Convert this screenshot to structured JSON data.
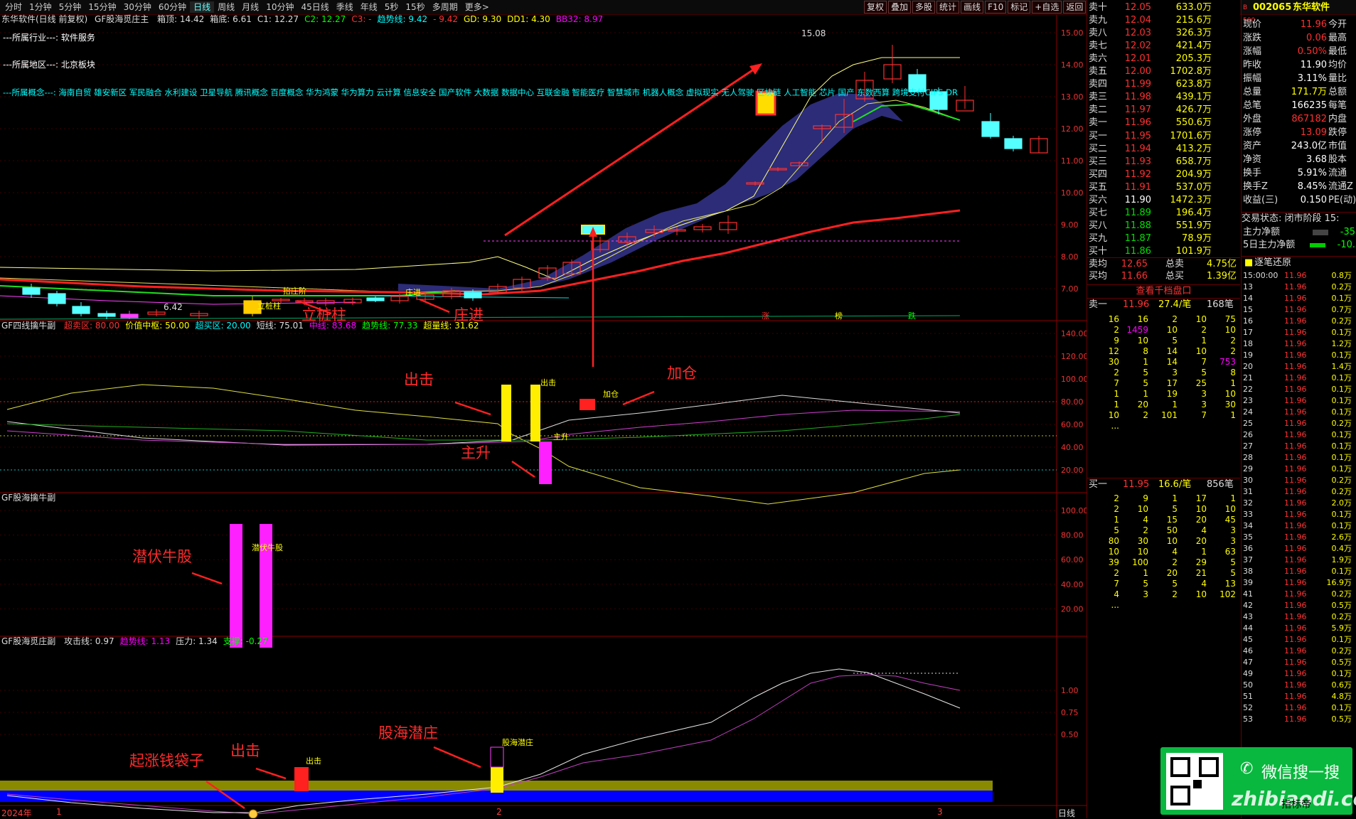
{
  "toolbar": {
    "periods": [
      "分时",
      "1分钟",
      "5分钟",
      "15分钟",
      "30分钟",
      "60分钟",
      "日线",
      "周线",
      "月线",
      "10分钟",
      "45日线",
      "季线",
      "年线",
      "5秒",
      "15秒",
      "多周期",
      "更多>"
    ],
    "active": "日线",
    "right_buttons": [
      "复权",
      "叠加",
      "多股",
      "统计",
      "画线",
      "F10",
      "标记",
      "+自选",
      "返回"
    ]
  },
  "main_panel": {
    "title_stock": "东华软件(日线 前复权)",
    "indicator": "GF股海觅庄主",
    "params": [
      {
        "t": "箱顶: 14.42",
        "c": "#ddd"
      },
      {
        "t": "箱底: 6.61",
        "c": "#ddd"
      },
      {
        "t": "C1: 12.27",
        "c": "#ddd"
      },
      {
        "t": "C2: 12.27",
        "c": "#0f0"
      },
      {
        "t": "C3: -",
        "c": "#f33"
      },
      {
        "t": "趋势线: 9.42",
        "c": "#0ff"
      },
      {
        "t": "- 9.42",
        "c": "#f33"
      },
      {
        "t": "GD: 9.30",
        "c": "#ff0"
      },
      {
        "t": "DD1: 4.30",
        "c": "#ff0"
      },
      {
        "t": "BB32: 8.97",
        "c": "#f0f"
      }
    ],
    "industry": "---所属行业---: 软件服务",
    "region": "---所属地区---: 北京板块",
    "concepts": "---所属概念---: 海南自贸 雄安新区 军民融合 水利建设 卫星导航 腾讯概念 百度概念 华为鸿蒙 华为算力 云计算 信息安全 国产软件 大数据 数据中心 互联金融 智能医疗 智慧城市 机器人概念 虚拟现实 无人驾驶 区块链 人工智能 芯片 国产 东数西算 跨境支付CIPS DR",
    "yticks": [
      "15.00",
      "14.00",
      "13.00",
      "12.00",
      "11.00",
      "10.00",
      "9.00",
      "8.00",
      "7.00"
    ],
    "high_label": "15.08",
    "low_label": "6.42",
    "small_labels": [
      "抬庄阶",
      "立桩柱",
      "庄进",
      "涨",
      "榜",
      "跌"
    ],
    "annotations": [
      "立桩柱",
      "庄进"
    ]
  },
  "panel2": {
    "title": "GF四线擒牛副",
    "params": [
      {
        "t": "超卖区: 80.00",
        "c": "#f33"
      },
      {
        "t": "价值中枢: 50.00",
        "c": "#ff0"
      },
      {
        "t": "超买区: 20.00",
        "c": "#0ff"
      },
      {
        "t": "短线: 75.01",
        "c": "#ddd"
      },
      {
        "t": "中线: 83.68",
        "c": "#f0f"
      },
      {
        "t": "趋势线: 77.33",
        "c": "#0f0"
      },
      {
        "t": "超量线: 31.62",
        "c": "#ff0"
      }
    ],
    "yticks": [
      "140.00",
      "120.00",
      "100.00",
      "80.00",
      "60.00",
      "40.00",
      "20.00"
    ],
    "small_labels": [
      "出击",
      "加仓",
      "主升"
    ],
    "annotations": [
      "出击",
      "加仓",
      "主升"
    ]
  },
  "panel3": {
    "title": "GF股海擒牛副",
    "yticks": [
      "100.00",
      "80.00",
      "60.00",
      "40.00",
      "20.00"
    ],
    "small_label": "潜伏牛股",
    "annotation": "潜伏牛股"
  },
  "panel4": {
    "title": "GF股海觅庄副",
    "params": [
      {
        "t": "攻击线: 0.97",
        "c": "#ddd"
      },
      {
        "t": "趋势线: 1.13",
        "c": "#f0f"
      },
      {
        "t": "压力: 1.34",
        "c": "#ddd"
      },
      {
        "t": "支撑: -0.27",
        "c": "#0f0"
      }
    ],
    "yticks": [
      "1.00",
      "0.75",
      "0.50"
    ],
    "small_labels": [
      "出击",
      "股海潜庄"
    ],
    "annotations": [
      "起涨钱袋子",
      "出击",
      "股海潜庄"
    ]
  },
  "xaxis": {
    "labels": [
      "2024年",
      "1",
      "2",
      "3"
    ],
    "period": "日线"
  },
  "orderbook": {
    "asks": [
      {
        "l": "卖十",
        "p": "12.05",
        "v": "633.0万"
      },
      {
        "l": "卖九",
        "p": "12.04",
        "v": "215.6万"
      },
      {
        "l": "卖八",
        "p": "12.03",
        "v": "326.3万"
      },
      {
        "l": "卖七",
        "p": "12.02",
        "v": "421.4万"
      },
      {
        "l": "卖六",
        "p": "12.01",
        "v": "205.3万"
      },
      {
        "l": "卖五",
        "p": "12.00",
        "v": "1702.8万"
      },
      {
        "l": "卖四",
        "p": "11.99",
        "v": "623.8万"
      },
      {
        "l": "卖三",
        "p": "11.98",
        "v": "439.1万"
      },
      {
        "l": "卖二",
        "p": "11.97",
        "v": "426.7万"
      },
      {
        "l": "卖一",
        "p": "11.96",
        "v": "550.6万"
      }
    ],
    "bids": [
      {
        "l": "买一",
        "p": "11.95",
        "v": "1701.6万"
      },
      {
        "l": "买二",
        "p": "11.94",
        "v": "413.2万"
      },
      {
        "l": "买三",
        "p": "11.93",
        "v": "658.7万"
      },
      {
        "l": "买四",
        "p": "11.92",
        "v": "204.9万"
      },
      {
        "l": "买五",
        "p": "11.91",
        "v": "537.0万"
      },
      {
        "l": "买六",
        "p": "11.90",
        "v": "1472.3万"
      },
      {
        "l": "买七",
        "p": "11.89",
        "v": "196.4万"
      },
      {
        "l": "买八",
        "p": "11.88",
        "v": "551.9万"
      },
      {
        "l": "买九",
        "p": "11.87",
        "v": "78.9万"
      },
      {
        "l": "买十",
        "p": "11.86",
        "v": "101.9万"
      }
    ],
    "avg_ask": {
      "l": "卖均",
      "p": "12.65",
      "s": "总卖",
      "v": "4.75亿"
    },
    "avg_bid": {
      "l": "买均",
      "p": "11.66",
      "s": "总买",
      "v": "1.39亿"
    },
    "thousand_btn": "查看千档盘口",
    "sell_queue_header": {
      "l": "卖一",
      "p": "11.96",
      "a": "27.4/笔",
      "n": "168笔"
    },
    "sell_queue": [
      [
        "16",
        "16",
        "2",
        "10",
        "75"
      ],
      [
        "2",
        "1459",
        "10",
        "2",
        "10"
      ],
      [
        "9",
        "10",
        "5",
        "1",
        "2"
      ],
      [
        "12",
        "8",
        "14",
        "10",
        "2"
      ],
      [
        "30",
        "1",
        "14",
        "7",
        "753"
      ],
      [
        "2",
        "5",
        "3",
        "5",
        "8"
      ],
      [
        "7",
        "5",
        "17",
        "25",
        "1"
      ],
      [
        "1",
        "1",
        "19",
        "3",
        "10"
      ],
      [
        "1",
        "20",
        "1",
        "3",
        "30"
      ],
      [
        "10",
        "2",
        "101",
        "7",
        "1"
      ],
      [
        "...",
        "",
        "",
        "",
        ""
      ]
    ],
    "buy_queue_header": {
      "l": "买一",
      "p": "11.95",
      "a": "16.6/笔",
      "n": "856笔"
    },
    "buy_queue": [
      [
        "2",
        "9",
        "1",
        "17",
        "1"
      ],
      [
        "2",
        "10",
        "5",
        "10",
        "10"
      ],
      [
        "1",
        "4",
        "15",
        "20",
        "45"
      ],
      [
        "5",
        "2",
        "50",
        "4",
        "3"
      ],
      [
        "80",
        "30",
        "10",
        "20",
        "3"
      ],
      [
        "10",
        "10",
        "4",
        "1",
        "63"
      ],
      [
        "39",
        "100",
        "2",
        "29",
        "5"
      ],
      [
        "2",
        "1",
        "20",
        "21",
        "5"
      ],
      [
        "7",
        "5",
        "5",
        "4",
        "13"
      ],
      [
        "4",
        "3",
        "2",
        "10",
        "102"
      ],
      [
        "...",
        "",
        "",
        "",
        ""
      ]
    ]
  },
  "quote": {
    "code": "002065",
    "name": "东华软件",
    "rows": [
      {
        "a": "现价",
        "b": "11.96",
        "bc": "red",
        "c": "今开"
      },
      {
        "a": "涨跌",
        "b": "0.06",
        "bc": "red",
        "c": "最高"
      },
      {
        "a": "涨幅",
        "b": "0.50%",
        "bc": "red",
        "c": "最低"
      },
      {
        "a": "昨收",
        "b": "11.90",
        "bc": "wht",
        "c": "均价"
      },
      {
        "a": "振幅",
        "b": "3.11%",
        "bc": "wht",
        "c": "量比"
      },
      {
        "a": "总量",
        "b": "171.7万",
        "bc": "yel",
        "c": "总额"
      },
      {
        "a": "总笔",
        "b": "166235",
        "bc": "wht",
        "c": "每笔"
      },
      {
        "a": "外盘",
        "b": "867182",
        "bc": "red",
        "c": "内盘"
      },
      {
        "a": "涨停",
        "b": "13.09",
        "bc": "red",
        "c": "跌停"
      },
      {
        "a": "资产",
        "b": "243.0亿",
        "bc": "wht",
        "c": "市值"
      },
      {
        "a": "净资",
        "b": "3.68",
        "bc": "wht",
        "c": "股本"
      },
      {
        "a": "换手",
        "b": "5.91%",
        "bc": "wht",
        "c": "流通"
      },
      {
        "a": "换手Z",
        "b": "8.45%",
        "bc": "wht",
        "c": "流通Z"
      },
      {
        "a": "收益(三)",
        "b": "0.150",
        "bc": "wht",
        "c": "PE(动)"
      }
    ],
    "trade_status": "交易状态: 闭市阶段 15:",
    "main_net": {
      "a": "主力净额",
      "v": "-35"
    },
    "main_net5": {
      "a": "5日主力净额",
      "v": "-10."
    },
    "ticks_title": "逐笔还原",
    "ticks": [
      {
        "t": "15:00:00",
        "p": "11.96",
        "v": "0.8万"
      },
      {
        "t": "13",
        "p": "11.96",
        "v": "0.2万"
      },
      {
        "t": "14",
        "p": "11.96",
        "v": "0.1万"
      },
      {
        "t": "15",
        "p": "11.96",
        "v": "0.7万"
      },
      {
        "t": "16",
        "p": "11.96",
        "v": "0.2万"
      },
      {
        "t": "17",
        "p": "11.96",
        "v": "0.1万"
      },
      {
        "t": "18",
        "p": "11.96",
        "v": "1.2万"
      },
      {
        "t": "19",
        "p": "11.96",
        "v": "0.1万"
      },
      {
        "t": "20",
        "p": "11.96",
        "v": "1.4万"
      },
      {
        "t": "21",
        "p": "11.96",
        "v": "0.1万"
      },
      {
        "t": "22",
        "p": "11.96",
        "v": "0.1万"
      },
      {
        "t": "23",
        "p": "11.96",
        "v": "0.1万"
      },
      {
        "t": "24",
        "p": "11.96",
        "v": "0.1万"
      },
      {
        "t": "25",
        "p": "11.96",
        "v": "0.2万"
      },
      {
        "t": "26",
        "p": "11.96",
        "v": "0.1万"
      },
      {
        "t": "27",
        "p": "11.96",
        "v": "0.1万"
      },
      {
        "t": "28",
        "p": "11.96",
        "v": "0.1万"
      },
      {
        "t": "29",
        "p": "11.96",
        "v": "0.1万"
      },
      {
        "t": "30",
        "p": "11.96",
        "v": "0.2万"
      },
      {
        "t": "31",
        "p": "11.96",
        "v": "0.2万"
      },
      {
        "t": "32",
        "p": "11.96",
        "v": "2.0万"
      },
      {
        "t": "33",
        "p": "11.96",
        "v": "0.1万"
      },
      {
        "t": "34",
        "p": "11.96",
        "v": "0.1万"
      },
      {
        "t": "35",
        "p": "11.96",
        "v": "2.6万"
      },
      {
        "t": "36",
        "p": "11.96",
        "v": "0.4万"
      },
      {
        "t": "37",
        "p": "11.96",
        "v": "1.9万"
      },
      {
        "t": "38",
        "p": "11.96",
        "v": "0.1万"
      },
      {
        "t": "39",
        "p": "11.96",
        "v": "16.9万"
      },
      {
        "t": "41",
        "p": "11.96",
        "v": "0.2万"
      },
      {
        "t": "42",
        "p": "11.96",
        "v": "0.5万"
      },
      {
        "t": "43",
        "p": "11.96",
        "v": "0.2万"
      },
      {
        "t": "44",
        "p": "11.96",
        "v": "5.9万"
      },
      {
        "t": "45",
        "p": "11.96",
        "v": "0.1万"
      },
      {
        "t": "46",
        "p": "11.96",
        "v": "0.2万"
      },
      {
        "t": "47",
        "p": "11.96",
        "v": "0.5万"
      },
      {
        "t": "49",
        "p": "11.96",
        "v": "0.1万"
      },
      {
        "t": "50",
        "p": "11.96",
        "v": "0.6万"
      },
      {
        "t": "51",
        "p": "11.96",
        "v": "4.8万"
      },
      {
        "t": "52",
        "p": "11.96",
        "v": "0.1万"
      },
      {
        "t": "53",
        "p": "11.96",
        "v": "0.5万"
      }
    ]
  },
  "watermark": {
    "search": "微信搜一搜",
    "brand": "zhibiaodi.com",
    "sub": "指标帝"
  },
  "colors": {
    "up": "#ff3030",
    "down": "#55ffff",
    "grid": "#4a0000",
    "cloud": "#2b2b7a"
  }
}
